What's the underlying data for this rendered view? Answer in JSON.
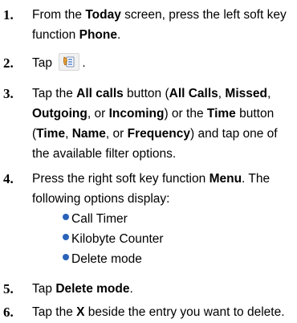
{
  "steps": [
    {
      "number": "1.",
      "text": [
        "From the ",
        "Today",
        " screen, press the left soft key function ",
        "Phone",
        "."
      ]
    },
    {
      "number": "2.",
      "text": [
        "Tap ",
        "."
      ],
      "icon": "phone-contacts-icon"
    },
    {
      "number": "3.",
      "text": [
        "Tap the ",
        "All calls",
        " button (",
        "All Calls",
        ", ",
        "Missed",
        ", ",
        "Outgoing",
        ", or ",
        "Incoming",
        ") or the ",
        "Time",
        " button (",
        "Time",
        ", ",
        "Name",
        ", or ",
        "Frequency",
        ") and tap one of the available filter options."
      ]
    },
    {
      "number": "4.",
      "text": [
        "Press the right soft key function ",
        "Menu",
        ". The following options display:"
      ],
      "options": [
        "Call Timer",
        "Kilobyte Counter",
        "Delete mode"
      ]
    },
    {
      "number": "5.",
      "text": [
        "Tap ",
        "Delete mode",
        "."
      ]
    },
    {
      "number": "6.",
      "text": [
        "Tap the ",
        "X",
        " beside the entry you want to delete."
      ]
    }
  ],
  "colors": {
    "bullet": "#2a63b8",
    "text": "#000000"
  }
}
